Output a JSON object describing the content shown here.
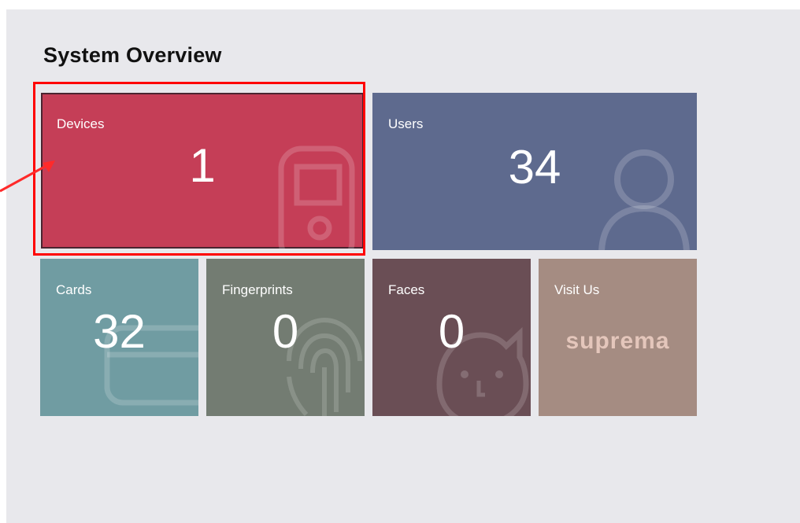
{
  "page": {
    "title": "System Overview"
  },
  "tiles": {
    "devices": {
      "label": "Devices",
      "count": "1",
      "color": "#c53e57",
      "icon": "device-terminal-icon"
    },
    "users": {
      "label": "Users",
      "count": "34",
      "color": "#5e6a8e",
      "icon": "user-icon"
    },
    "cards": {
      "label": "Cards",
      "count": "32",
      "color": "#709ca2",
      "icon": "card-icon"
    },
    "fingerprints": {
      "label": "Fingerprints",
      "count": "0",
      "color": "#737c72",
      "icon": "fingerprint-icon"
    },
    "faces": {
      "label": "Faces",
      "count": "0",
      "color": "#6a4e55",
      "icon": "face-icon"
    },
    "visit": {
      "label": "Visit Us",
      "brand": "suprema",
      "color": "#a58c82"
    }
  },
  "annotation": {
    "highlight_color": "#ff0000",
    "target": "devices"
  }
}
